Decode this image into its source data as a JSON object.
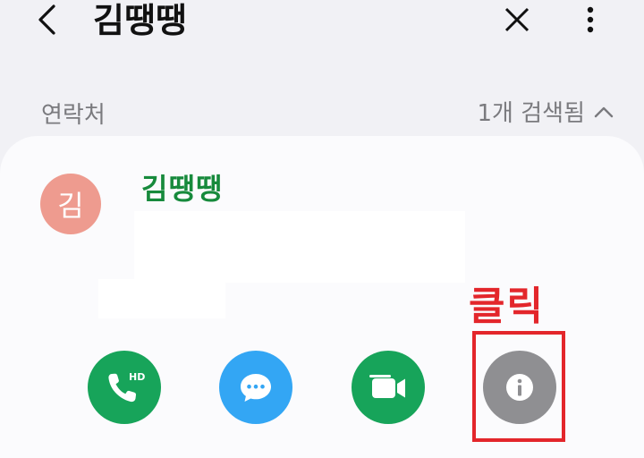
{
  "header": {
    "title": "김땡땡"
  },
  "search": {
    "section_label": "연락처",
    "result_count": "1개 검색됨"
  },
  "contact": {
    "avatar_initial": "김",
    "name": "김땡땡"
  },
  "annotation": {
    "label": "클릭",
    "color": "#e3262b"
  },
  "actions": [
    {
      "name": "hd-voice-call",
      "icon": "phone-hd-icon",
      "badge": "HD",
      "color": "#17a45a"
    },
    {
      "name": "message",
      "icon": "chat-bubble-icon",
      "color": "#33a6f4"
    },
    {
      "name": "video-call",
      "icon": "video-camera-icon",
      "color": "#17a45a"
    },
    {
      "name": "contact-info",
      "icon": "info-icon",
      "color": "#8f8f92"
    }
  ],
  "colors": {
    "background": "#f1f1f5",
    "card": "#fbfbfd",
    "name_green": "#178a3c",
    "avatar": "#ee9b8f"
  }
}
